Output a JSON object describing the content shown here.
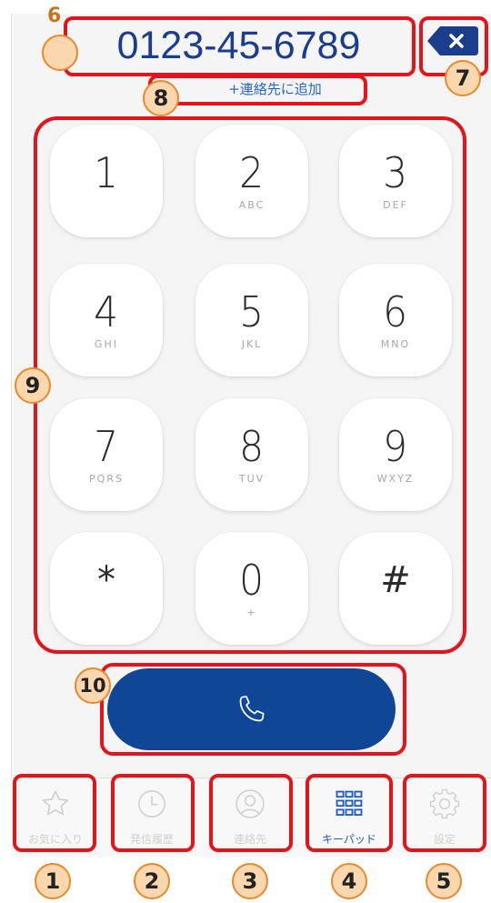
{
  "display": {
    "number": "0123-45-6789",
    "add_contact": "+連絡先に追加",
    "backspace_icon": "backspace-x-icon"
  },
  "keypad": {
    "keys": [
      {
        "digit": "1",
        "letters": ""
      },
      {
        "digit": "2",
        "letters": "ABC"
      },
      {
        "digit": "3",
        "letters": "DEF"
      },
      {
        "digit": "4",
        "letters": "GHI"
      },
      {
        "digit": "5",
        "letters": "JKL"
      },
      {
        "digit": "6",
        "letters": "MNO"
      },
      {
        "digit": "7",
        "letters": "PQRS"
      },
      {
        "digit": "8",
        "letters": "TUV"
      },
      {
        "digit": "9",
        "letters": "WXYZ"
      },
      {
        "digit": "*",
        "letters": ""
      },
      {
        "digit": "0",
        "letters": "+"
      },
      {
        "digit": "#",
        "letters": ""
      }
    ]
  },
  "call_button": {
    "icon": "phone-handset-icon"
  },
  "tabbar": {
    "tabs": [
      {
        "label": "お気に入り",
        "icon": "star-icon",
        "active": false
      },
      {
        "label": "発信履歴",
        "icon": "clock-icon",
        "active": false
      },
      {
        "label": "連絡先",
        "icon": "person-icon",
        "active": false
      },
      {
        "label": "キーパッド",
        "icon": "keypad-grid-icon",
        "active": true
      },
      {
        "label": "設定",
        "icon": "gear-icon",
        "active": false
      }
    ]
  },
  "annotations": {
    "badges": [
      "1",
      "2",
      "3",
      "4",
      "5",
      "6",
      "7",
      "8",
      "9",
      "10"
    ]
  },
  "colors": {
    "number_text": "#1a3e8c",
    "accent_blue": "#1f5bc0",
    "call_button": "#0f4695",
    "annotation_red": "#e3141c",
    "badge_fill": "#fbd7b0",
    "badge_border": "#e88a2c"
  }
}
